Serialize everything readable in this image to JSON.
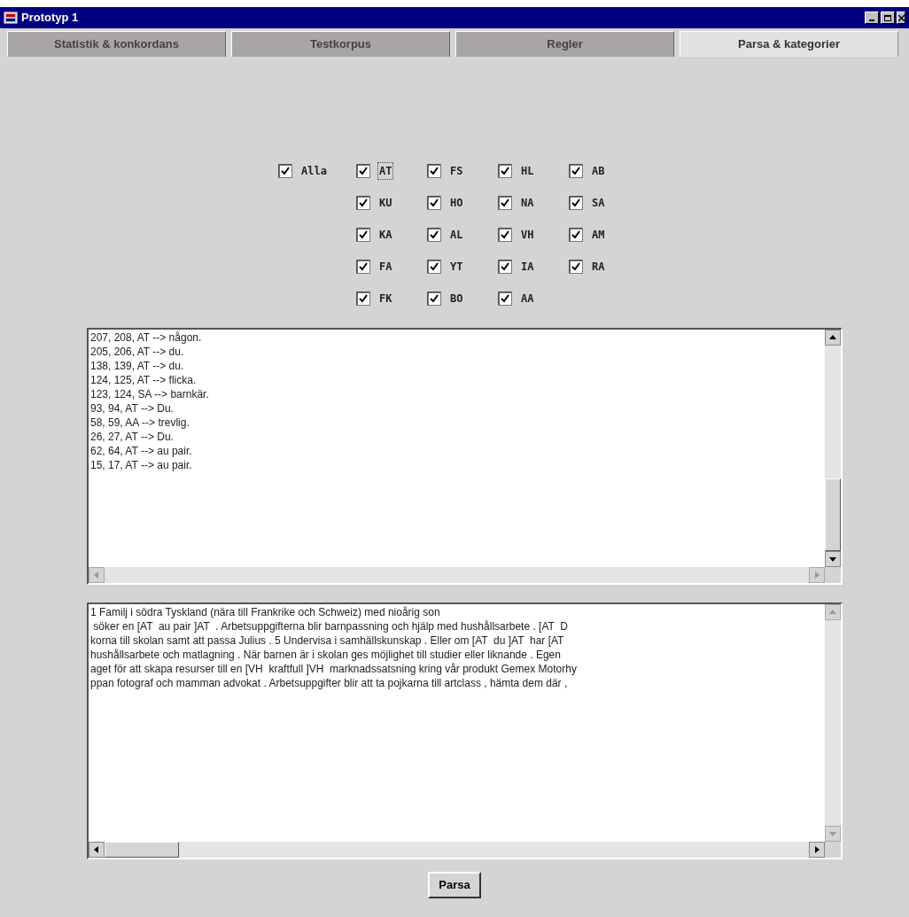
{
  "window": {
    "title": "Prototyp 1"
  },
  "tabs": [
    {
      "label": "Statistik & konkordans",
      "selected": false
    },
    {
      "label": "Testkorpus",
      "selected": false
    },
    {
      "label": "Regler",
      "selected": false
    },
    {
      "label": "Parsa & kategorier",
      "selected": true
    }
  ],
  "all_checkbox": {
    "label": "Alla",
    "checked": true
  },
  "category_rows": [
    [
      {
        "label": "AT",
        "checked": true,
        "focused": true
      },
      {
        "label": "FS",
        "checked": true
      },
      {
        "label": "HL",
        "checked": true
      },
      {
        "label": "AB",
        "checked": true
      }
    ],
    [
      {
        "label": "KU",
        "checked": true
      },
      {
        "label": "HO",
        "checked": true
      },
      {
        "label": "NA",
        "checked": true
      },
      {
        "label": "SA",
        "checked": true
      }
    ],
    [
      {
        "label": "KA",
        "checked": true
      },
      {
        "label": "AL",
        "checked": true
      },
      {
        "label": "VH",
        "checked": true
      },
      {
        "label": "AM",
        "checked": true
      }
    ],
    [
      {
        "label": "FA",
        "checked": true
      },
      {
        "label": "YT",
        "checked": true
      },
      {
        "label": "IA",
        "checked": true
      },
      {
        "label": "RA",
        "checked": true
      }
    ],
    [
      {
        "label": "FK",
        "checked": true
      },
      {
        "label": "BO",
        "checked": true
      },
      {
        "label": "AA",
        "checked": true
      }
    ]
  ],
  "results": [
    "207, 208, AT --> någon.",
    "205, 206, AT --> du.",
    "138, 139, AT --> du.",
    "124, 125, AT --> flicka.",
    "123, 124, SA --> barnkär.",
    "93, 94, AT --> Du.",
    "58, 59, AA --> trevlig.",
    "26, 27, AT --> Du.",
    "62, 64, AT --> au pair.",
    "15, 17, AT --> au pair."
  ],
  "corpus_lines": [
    "1 Familj i södra Tyskland (nära till Frankrike och Schweiz) med nioårig son",
    " söker en [AT  au pair ]AT  . Arbetsuppgifterna blir barnpassning och hjälp med hushållsarbete . [AT  D",
    "korna till skolan samt att passa Julius . 5 Undervisa i samhällskunskap . Eller om [AT  du ]AT  har [AT",
    "hushållsarbete och matlagning . När barnen är i skolan ges möjlighet till studier eller liknande . Egen",
    "aget för att skapa resurser till en [VH  kraftfull ]VH  marknadssatsning kring vår produkt Gemex Motorhy",
    "ppan fotograf och mamman advokat . Arbetsuppgifter blir att ta pojkarna till artclass , hämta dem där ,"
  ],
  "parse_button": {
    "label": "Parsa"
  }
}
